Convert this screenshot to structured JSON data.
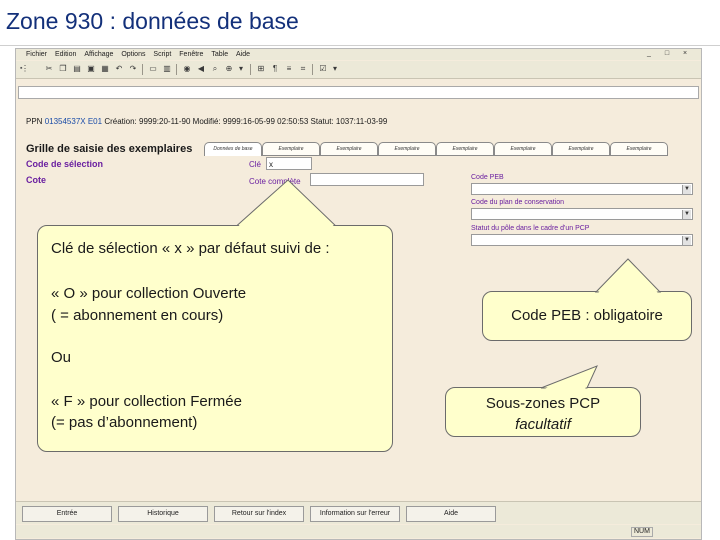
{
  "slide": {
    "title": "Zone 930 : données de base"
  },
  "menu": [
    "Fichier",
    "Edition",
    "Affichage",
    "Options",
    "Script",
    "Fenêtre",
    "Table",
    "Aide"
  ],
  "window_controls": [
    "_",
    "□",
    "×"
  ],
  "record": {
    "ppn_label": "PPN",
    "ppn_value": "01354537X E01",
    "meta": "Création: 9999:20-11-90 Modifié: 9999:16-05-99 02:50:53 Statut: 1037:11-03-99"
  },
  "grid": {
    "title": "Grille de saisie des exemplaires",
    "tabs": [
      "Données de base",
      "Exemplaire",
      "Exemplaire",
      "Exemplaire",
      "Exemplaire",
      "Exemplaire",
      "Exemplaire",
      "Exemplaire"
    ],
    "code_selection_label": "Code de sélection",
    "cote_label": "Cote",
    "cle_label": "Clé",
    "cle_value": "x",
    "cote_complete_label": "Cote complète",
    "code_peb_label": "Code PEB",
    "code_plan_label": "Code du plan de conservation",
    "statut_pole_label": "Statut du pôle dans le cadre d'un PCP"
  },
  "buttons": [
    "Entrée",
    "Historique",
    "Retour sur l'index",
    "Information sur l'erreur",
    "Aide"
  ],
  "status": {
    "num": "NUM"
  },
  "callouts": {
    "cle": {
      "line1": "Clé de sélection « x » par défaut suivi de :",
      "line2": "« O » pour collection Ouverte",
      "line3": "( = abonnement en cours)",
      "line4": "Ou",
      "line5": "« F » pour collection Fermée",
      "line6": "(= pas d’abonnement)"
    },
    "peb": {
      "text": "Code PEB : obligatoire"
    },
    "pcp": {
      "line1": "Sous-zones PCP",
      "line2": "facultatif"
    }
  },
  "colors": {
    "title": "#13307a",
    "app_bg": "#f5ecdc",
    "label_purple": "#6a1fa0",
    "callout_bg": "#ffffcc",
    "ppn_blue": "#1a4ca8"
  }
}
